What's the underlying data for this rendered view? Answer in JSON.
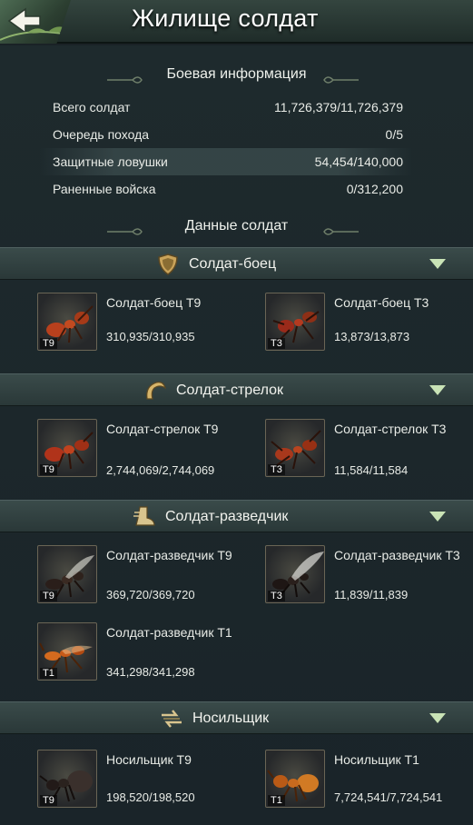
{
  "header": {
    "title": "Жилище солдат"
  },
  "battle_info": {
    "title": "Боевая информация",
    "rows": [
      {
        "label": "Всего солдат",
        "value": "11,726,379/11,726,379"
      },
      {
        "label": "Очередь похода",
        "value": "0/5"
      },
      {
        "label": "Защитные ловушки",
        "value": "54,454/140,000"
      },
      {
        "label": "Раненные войска",
        "value": "0/312,200"
      }
    ]
  },
  "soldier_data": {
    "title": "Данные солдат"
  },
  "categories": [
    {
      "label": "Солдат-боец",
      "icon": "shield-icon",
      "units": [
        {
          "name": "Солдат-боец T9",
          "tier": "T9",
          "count": "310,935/310,935"
        },
        {
          "name": "Солдат-боец T3",
          "tier": "T3",
          "count": "13,873/13,873"
        }
      ]
    },
    {
      "label": "Солдат-стрелок",
      "icon": "claw-icon",
      "units": [
        {
          "name": "Солдат-стрелок T9",
          "tier": "T9",
          "count": "2,744,069/2,744,069"
        },
        {
          "name": "Солдат-стрелок T3",
          "tier": "T3",
          "count": "11,584/11,584"
        }
      ]
    },
    {
      "label": "Солдат-разведчик",
      "icon": "boot-icon",
      "units": [
        {
          "name": "Солдат-разведчик T9",
          "tier": "T9",
          "count": "369,720/369,720"
        },
        {
          "name": "Солдат-разведчик T3",
          "tier": "T3",
          "count": "11,839/11,839"
        },
        {
          "name": "Солдат-разведчик T1",
          "tier": "T1",
          "count": "341,298/341,298"
        }
      ]
    },
    {
      "label": "Носильщик",
      "icon": "arrows-icon",
      "units": [
        {
          "name": "Носильщик T9",
          "tier": "T9",
          "count": "198,520/198,520"
        },
        {
          "name": "Носильщик T1",
          "tier": "T1",
          "count": "7,724,541/7,724,541"
        }
      ]
    }
  ],
  "colors": {
    "accent_chevron": "#c9e3b6",
    "panel": "#2f3e3e",
    "bg": "#1c262a"
  }
}
